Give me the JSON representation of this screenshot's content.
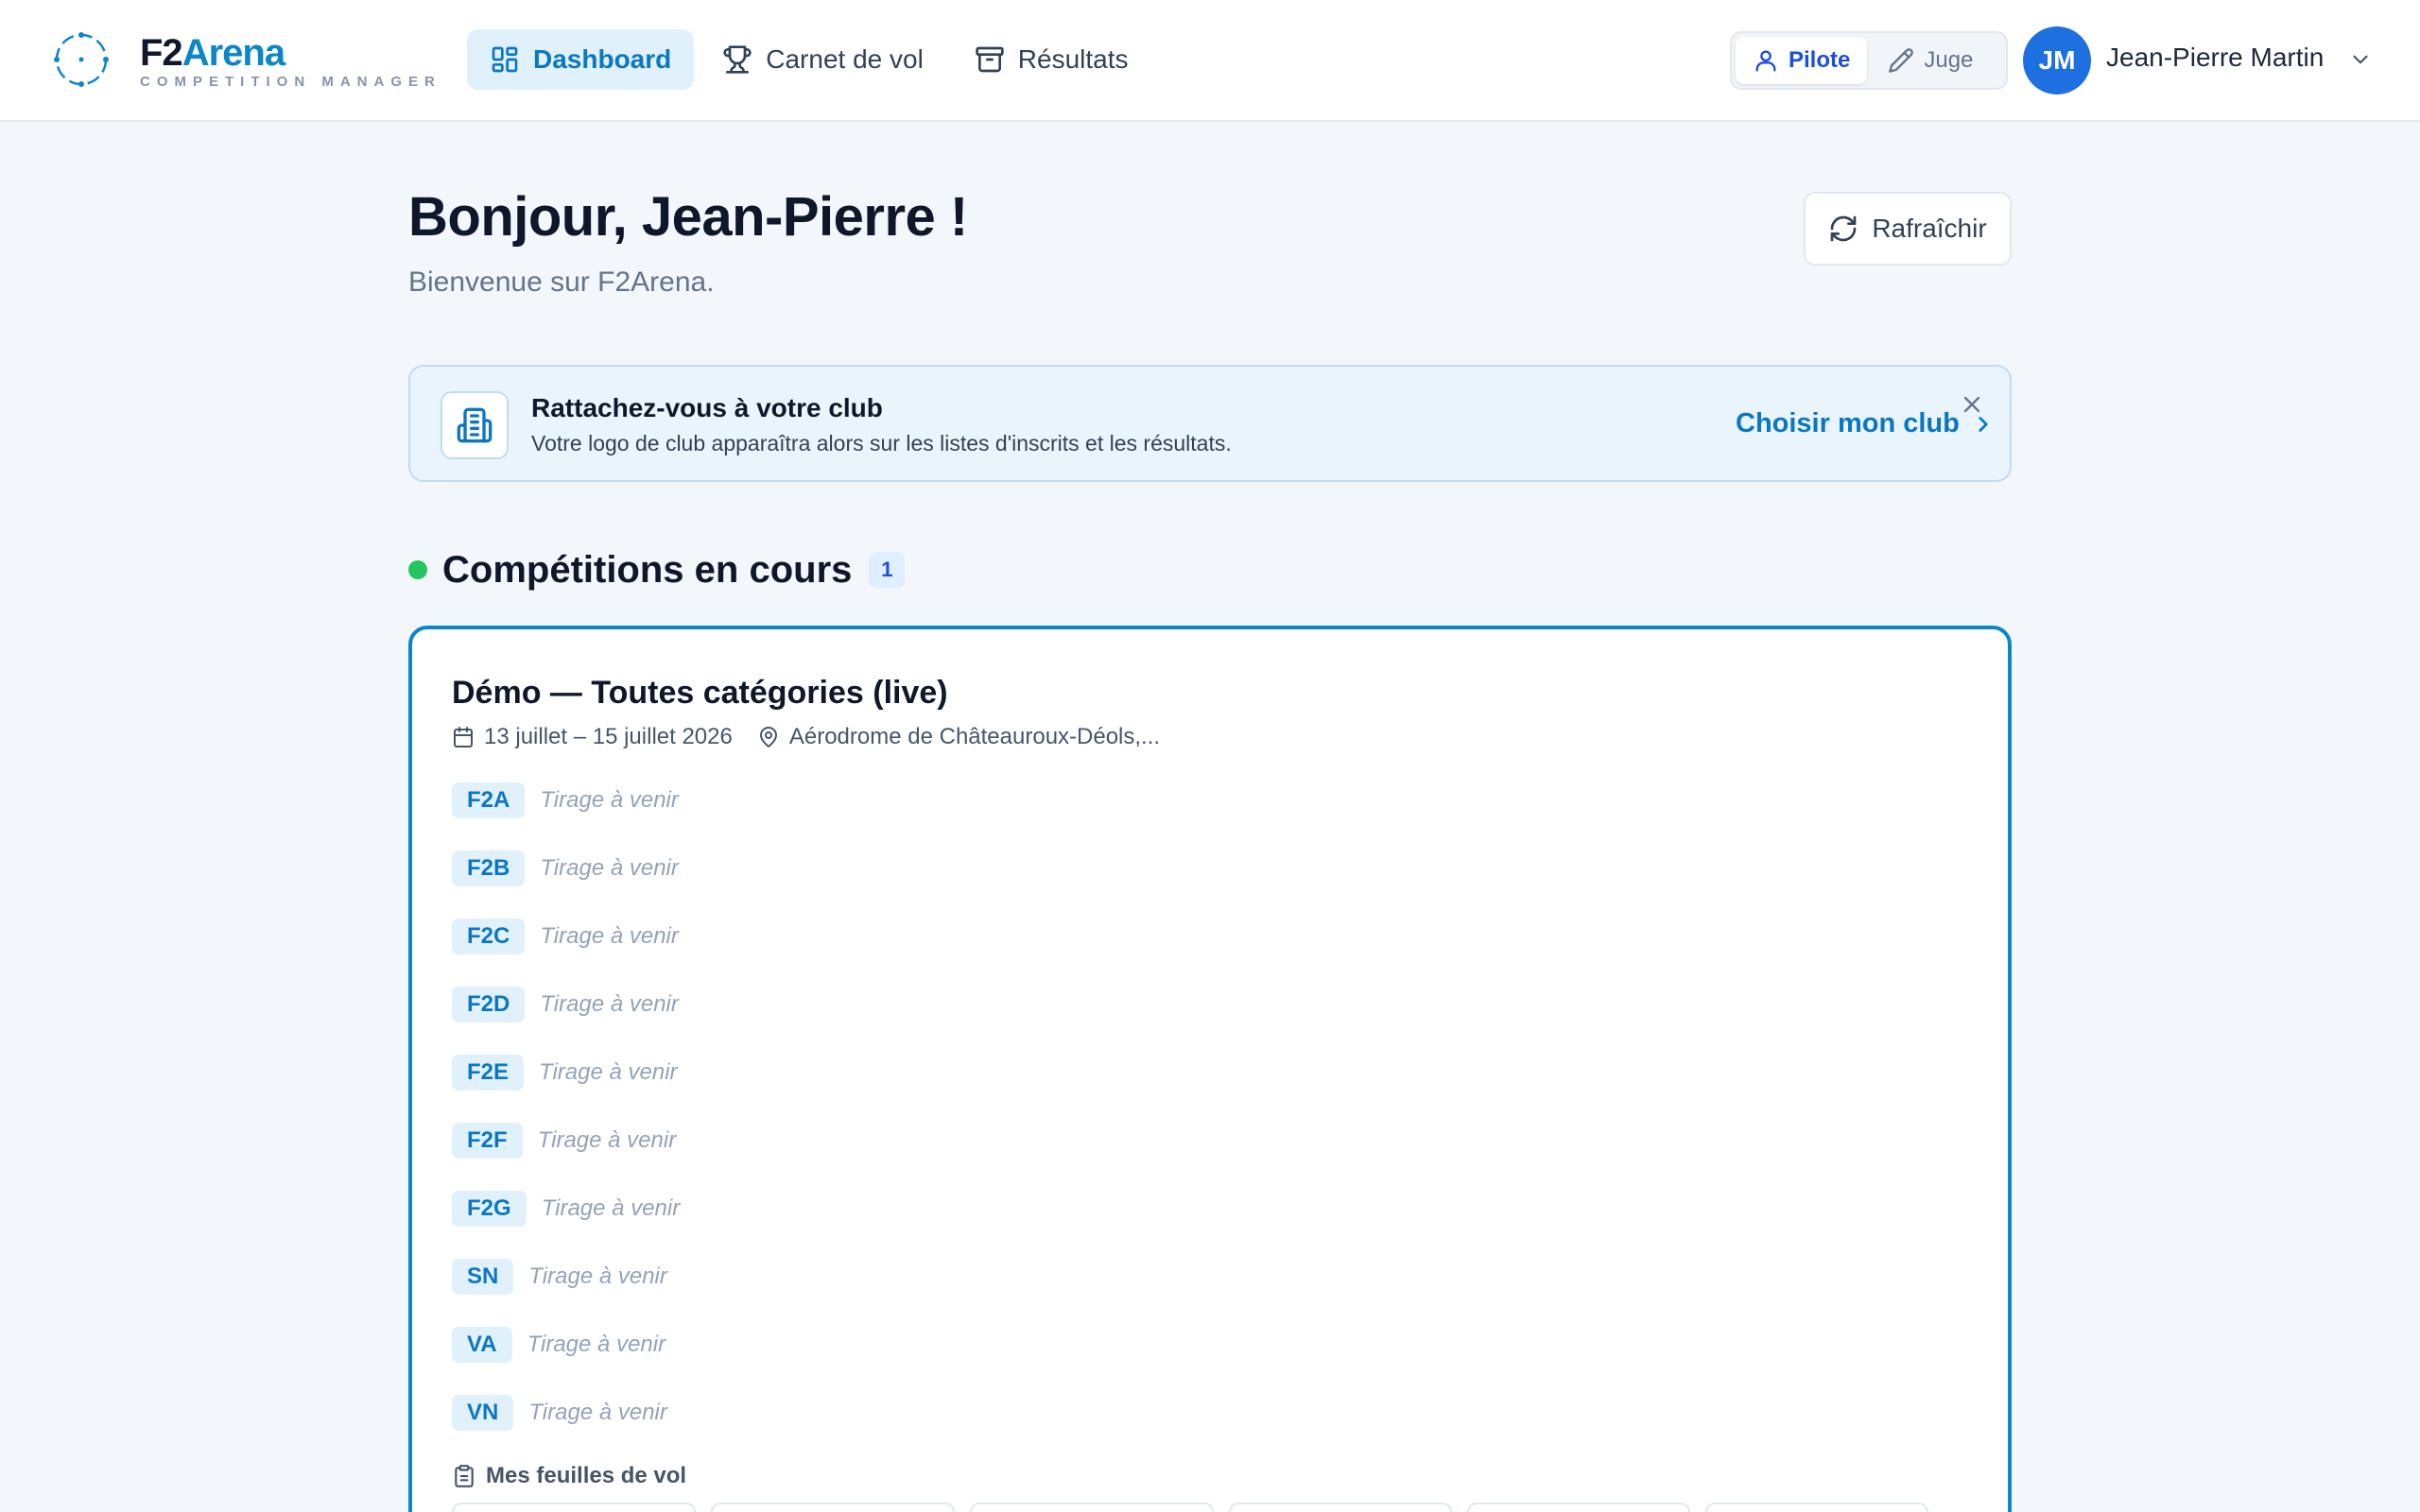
{
  "brand": {
    "name_part1": "F2",
    "name_part2": "Arena",
    "subtitle": "COMPETITION MANAGER"
  },
  "nav": {
    "items": [
      {
        "label": "Dashboard",
        "icon": "dashboard-grid-icon",
        "active": true
      },
      {
        "label": "Carnet de vol",
        "icon": "trophy-icon",
        "active": false
      },
      {
        "label": "Résultats",
        "icon": "archive-box-icon",
        "active": false
      }
    ]
  },
  "role_switch": {
    "pilot_label": "Pilote",
    "judge_label": "Juge",
    "active": "Pilote"
  },
  "user": {
    "initials": "JM",
    "name": "Jean-Pierre Martin"
  },
  "page": {
    "greeting": "Bonjour, Jean-Pierre !",
    "welcome": "Bienvenue sur F2Arena.",
    "refresh_label": "Rafraîchir"
  },
  "club_banner": {
    "title": "Rattachez-vous à votre club",
    "description": "Votre logo de club apparaîtra alors sur les listes d'inscrits et les résultats.",
    "cta_label": "Choisir mon club"
  },
  "section": {
    "title": "Compétitions en cours",
    "count": "1"
  },
  "competition": {
    "title": "Démo — Toutes catégories (live)",
    "dates": "13 juillet – 15 juillet 2026",
    "location": "Aérodrome de Châteauroux-Déols,...",
    "categories": [
      {
        "code": "F2A",
        "status": "Tirage à venir"
      },
      {
        "code": "F2B",
        "status": "Tirage à venir"
      },
      {
        "code": "F2C",
        "status": "Tirage à venir"
      },
      {
        "code": "F2D",
        "status": "Tirage à venir"
      },
      {
        "code": "F2E",
        "status": "Tirage à venir"
      },
      {
        "code": "F2F",
        "status": "Tirage à venir"
      },
      {
        "code": "F2G",
        "status": "Tirage à venir"
      },
      {
        "code": "SN",
        "status": "Tirage à venir"
      },
      {
        "code": "VA",
        "status": "Tirage à venir"
      },
      {
        "code": "VN",
        "status": "Tirage à venir"
      }
    ],
    "sheets_label": "Mes feuilles de vol"
  },
  "colors": {
    "accent": "#0b86c9",
    "live": "#22c55e",
    "avatar": "#1e6fe0"
  }
}
